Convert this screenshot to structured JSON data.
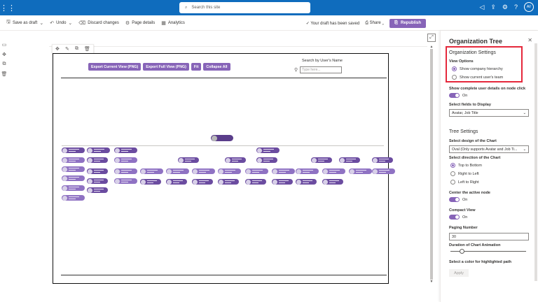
{
  "suite": {
    "search_placeholder": "Search this site",
    "avatar": "AV"
  },
  "cmdbar": {
    "save_as_draft": "Save as draft",
    "undo": "Undo",
    "discard": "Discard changes",
    "page_details": "Page details",
    "analytics": "Analytics",
    "draft_status": "Your draft has been saved",
    "share": "Share",
    "republish": "Republish"
  },
  "webpart": {
    "buttons": [
      "Export Current View (PNG)",
      "Export Full View (PNG)",
      "Fit",
      "Collapse All"
    ],
    "search_label": "Search by User's Name",
    "search_placeholder": "Type here..."
  },
  "panel": {
    "title": "Organization Tree",
    "org_settings": "Organization Settings",
    "view_options": "View Options",
    "view_radio_1": "Show company hierarchy",
    "view_radio_2": "Show current user's team",
    "show_details_label": "Show complete user details on node click",
    "show_details_value": "On",
    "fields_label": "Select fields to Display",
    "fields_value": "Avatar, Job Title",
    "tree_settings": "Tree Settings",
    "design_label": "Select design of the Chart",
    "design_value": "Oval (Only supports Avatar and Job Ti...",
    "direction_label": "Select direction of the Chart",
    "dir_1": "Top to Bottom",
    "dir_2": "Right to Left",
    "dir_3": "Left to Right",
    "center_label": "Center the active node",
    "center_value": "On",
    "compact_label": "Compact View",
    "compact_value": "On",
    "paging_label": "Paging Number",
    "paging_value": "30",
    "duration_label": "Duration of Chart Animation",
    "duration_level": 0.12,
    "color_label": "Select a color for highlighted path",
    "apply": "Apply"
  }
}
